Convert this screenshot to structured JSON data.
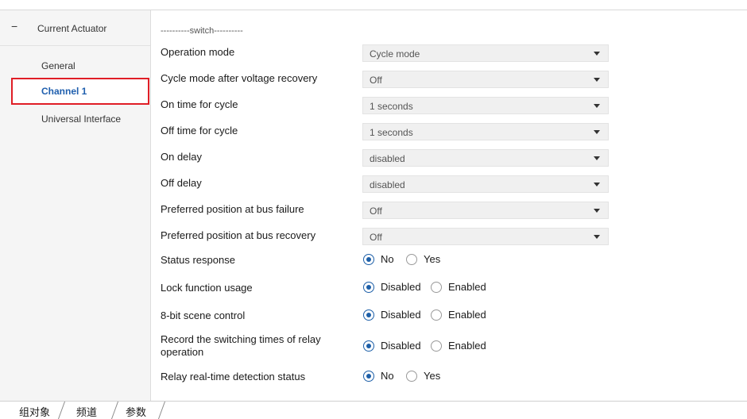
{
  "sidebar": {
    "root": {
      "toggle": "−",
      "label": "Current Actuator"
    },
    "items": [
      {
        "label": "General"
      },
      {
        "label": "Channel 1"
      },
      {
        "label": "Universal Interface"
      }
    ]
  },
  "main": {
    "section_title": "----------switch----------",
    "dropdowns": [
      {
        "label": "Operation mode",
        "value": "Cycle mode"
      },
      {
        "label": "Cycle mode after voltage recovery",
        "value": "Off"
      },
      {
        "label": "On time for cycle",
        "value": "1 seconds"
      },
      {
        "label": "Off time for cycle",
        "value": "1 seconds"
      },
      {
        "label": "On delay",
        "value": "disabled"
      },
      {
        "label": "Off delay",
        "value": "disabled"
      },
      {
        "label": "Preferred position at bus failure",
        "value": "Off"
      },
      {
        "label": "Preferred position at bus recovery",
        "value": "Off"
      }
    ],
    "radios": [
      {
        "label": "Status response",
        "opt1": "No",
        "opt2": "Yes",
        "selected": "No"
      },
      {
        "label": "Lock function usage",
        "opt1": "Disabled",
        "opt2": "Enabled",
        "selected": "Disabled"
      },
      {
        "label": "8-bit scene control",
        "opt1": "Disabled",
        "opt2": "Enabled",
        "selected": "Disabled"
      },
      {
        "label_line1": "Record the switching times of relay",
        "label_line2": "operation",
        "opt1": "Disabled",
        "opt2": "Enabled",
        "selected": "Disabled"
      },
      {
        "label": "Relay real-time detection status",
        "opt1": "No",
        "opt2": "Yes",
        "selected": "No"
      }
    ]
  },
  "bottom_tabs": [
    {
      "label": "组对象"
    },
    {
      "label": "频道"
    },
    {
      "label": "参数"
    }
  ],
  "colors": {
    "selection_border": "#e01e26",
    "selected_text": "#1f5fae",
    "radio_accent": "#1d5fa8"
  }
}
